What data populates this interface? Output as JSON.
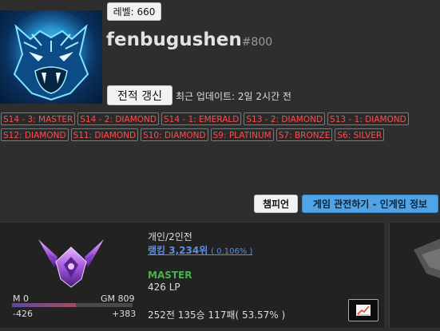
{
  "profile": {
    "level_label": "레벨: 660",
    "name": "fenbugushen",
    "tag": "#800",
    "refresh_label": "전적 갱신",
    "last_update": "최근 업데이트: 2일 2시간 전"
  },
  "seasons": {
    "row1": [
      "S14 - 3: MASTER",
      "S14 - 2: DIAMOND",
      "S14 - 1: EMERALD",
      "S13 - 2: DIAMOND",
      "S13 - 1: DIAMOND"
    ],
    "row2": [
      "S12: DIAMOND",
      "S11: DIAMOND",
      "S10: DIAMOND",
      "S9: PLATINUM",
      "S7: BRONZE",
      "S6: SILVER"
    ]
  },
  "actions": {
    "champion_label": "챔피언",
    "spectate_label": "게임 관전하기 - 인게임 정보"
  },
  "rank": {
    "queue": "개인/2인전",
    "ranking_label": "랭킹 3,234위",
    "ranking_percent": "( 0.106% )",
    "tier": "MASTER",
    "lp": "426 LP",
    "record": "252전 135승 117패( 53.57% )",
    "lp_min": "M 0",
    "lp_max": "GM 809",
    "lp_neg": "-426",
    "lp_pos": "+383",
    "lp_progress": 0.527
  },
  "colors": {
    "season_text": "#ff4d4d",
    "master_green": "#4caf50",
    "ranking_blue": "#5b8fe0",
    "spectate_blue": "#4fa3e6"
  }
}
